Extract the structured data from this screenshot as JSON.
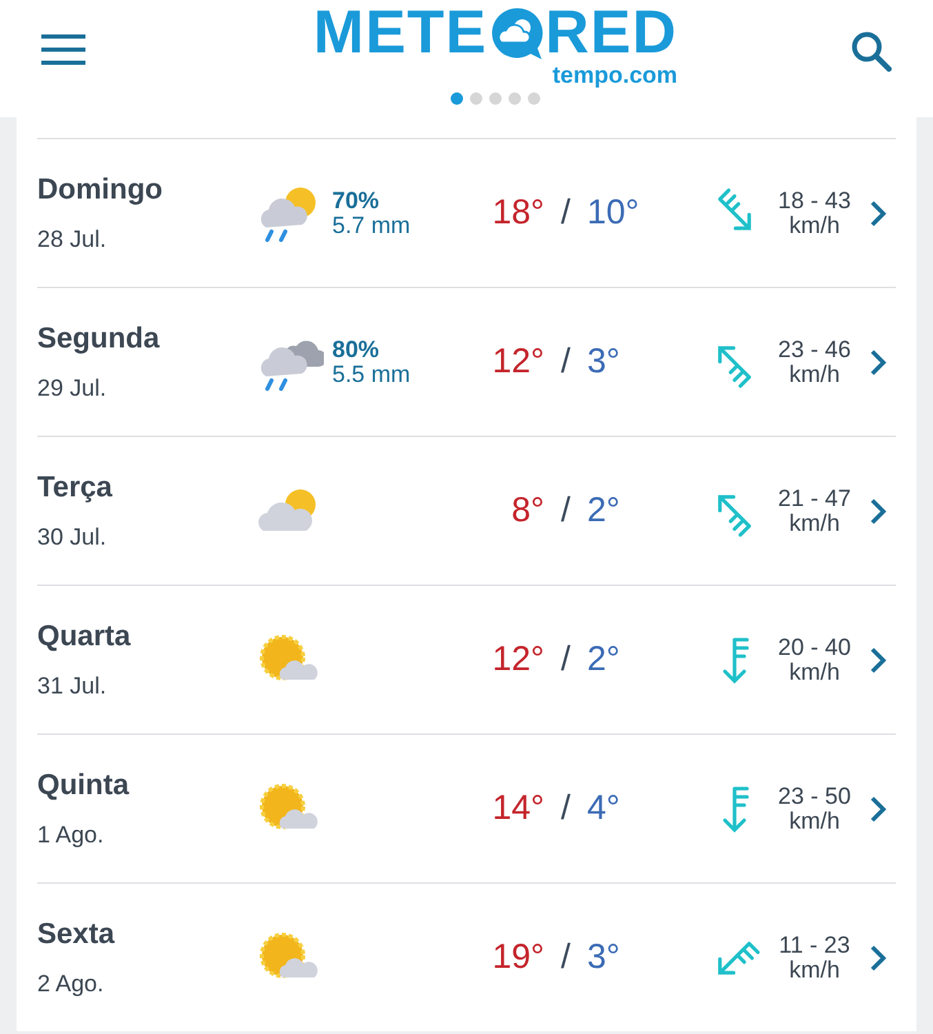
{
  "header": {
    "logo_left": "METE",
    "logo_right": "RED",
    "logo_sub": "tempo.com",
    "pager": [
      {
        "selected": true
      },
      {
        "selected": false
      },
      {
        "selected": false
      },
      {
        "selected": false
      },
      {
        "selected": false
      }
    ]
  },
  "days": [
    {
      "day": "Domingo",
      "date": "28 Jul.",
      "kind": "sun_cloud_rain",
      "chance": "70%",
      "rain": "5.7 mm",
      "high": "18°",
      "sep": "/",
      "low": "10°",
      "wind": {
        "kind": "se",
        "speed": "18 - 43",
        "unit": "km/h"
      }
    },
    {
      "day": "Segunda",
      "date": "29 Jul.",
      "kind": "cloud_rain",
      "chance": "80%",
      "rain": "5.5 mm",
      "high": "12°",
      "sep": "/",
      "low": "3°",
      "wind": {
        "kind": "nw",
        "speed": "23 - 46",
        "unit": "km/h"
      }
    },
    {
      "day": "Terça",
      "date": "30 Jul.",
      "kind": "cloud_sun",
      "high": "8°",
      "sep": "/",
      "low": "2°",
      "wind": {
        "kind": "nw",
        "speed": "21 - 47",
        "unit": "km/h"
      }
    },
    {
      "day": "Quarta",
      "date": "31 Jul.",
      "kind": "sun_cloud",
      "high": "12°",
      "sep": "/",
      "low": "2°",
      "wind": {
        "kind": "s",
        "speed": "20 - 40",
        "unit": "km/h"
      }
    },
    {
      "day": "Quinta",
      "date": "1 Ago.",
      "kind": "sun_cloud",
      "high": "14°",
      "sep": "/",
      "low": "4°",
      "wind": {
        "kind": "s",
        "speed": "23 - 50",
        "unit": "km/h"
      }
    },
    {
      "day": "Sexta",
      "date": "2 Ago.",
      "kind": "sun_cloud",
      "high": "19°",
      "sep": "/",
      "low": "3°",
      "wind": {
        "kind": "sw",
        "speed": "11 - 23",
        "unit": "km/h"
      }
    }
  ]
}
